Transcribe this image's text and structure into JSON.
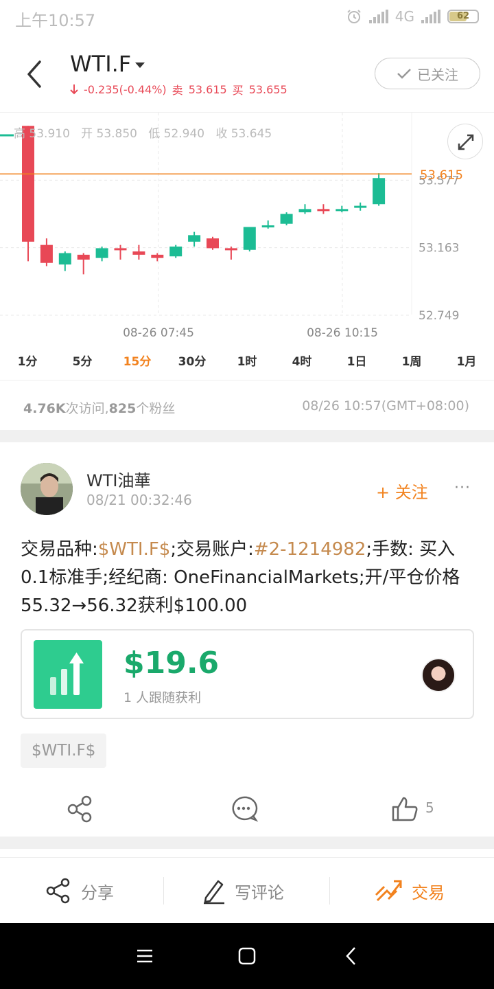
{
  "status_bar": {
    "time": "上午10:57",
    "network": "4G",
    "battery": "62"
  },
  "header": {
    "symbol": "WTI.F",
    "change": "-0.235(-0.44%)",
    "sell_label": "卖",
    "sell_price": "53.615",
    "buy_label": "买",
    "buy_price": "53.655",
    "follow_state": "已关注"
  },
  "chart_data": {
    "type": "candlestick",
    "ohlc_summary": {
      "high": "高 53.910",
      "open": "开 53.850",
      "low": "低 52.940",
      "close": "收 53.645"
    },
    "current_price": 53.615,
    "y_ticks": [
      "53.577",
      "53.163",
      "52.749"
    ],
    "ylim": [
      52.749,
      53.991
    ],
    "x_ticks": [
      "08-26 07:45",
      "08-26 10:15"
    ],
    "candles": [
      {
        "o": 53.91,
        "h": 53.91,
        "l": 53.08,
        "c": 53.2
      },
      {
        "o": 53.18,
        "h": 53.22,
        "l": 53.05,
        "c": 53.07
      },
      {
        "o": 53.06,
        "h": 53.14,
        "l": 53.02,
        "c": 53.13
      },
      {
        "o": 53.12,
        "h": 53.13,
        "l": 53.0,
        "c": 53.09
      },
      {
        "o": 53.1,
        "h": 53.17,
        "l": 53.08,
        "c": 53.16
      },
      {
        "o": 53.16,
        "h": 53.18,
        "l": 53.09,
        "c": 53.15
      },
      {
        "o": 53.14,
        "h": 53.18,
        "l": 53.09,
        "c": 53.12
      },
      {
        "o": 53.12,
        "h": 53.13,
        "l": 53.08,
        "c": 53.1
      },
      {
        "o": 53.11,
        "h": 53.18,
        "l": 53.1,
        "c": 53.17
      },
      {
        "o": 53.2,
        "h": 53.26,
        "l": 53.17,
        "c": 53.24
      },
      {
        "o": 53.22,
        "h": 53.23,
        "l": 53.15,
        "c": 53.16
      },
      {
        "o": 53.16,
        "h": 53.17,
        "l": 53.09,
        "c": 53.15
      },
      {
        "o": 53.15,
        "h": 53.29,
        "l": 53.14,
        "c": 53.29
      },
      {
        "o": 53.29,
        "h": 53.33,
        "l": 53.28,
        "c": 53.3
      },
      {
        "o": 53.31,
        "h": 53.38,
        "l": 53.3,
        "c": 53.37
      },
      {
        "o": 53.38,
        "h": 53.43,
        "l": 53.37,
        "c": 53.4
      },
      {
        "o": 53.4,
        "h": 53.43,
        "l": 53.37,
        "c": 53.39
      },
      {
        "o": 53.39,
        "h": 53.42,
        "l": 53.38,
        "c": 53.4
      },
      {
        "o": 53.41,
        "h": 53.44,
        "l": 53.39,
        "c": 53.42
      },
      {
        "o": 53.43,
        "h": 53.62,
        "l": 53.42,
        "c": 53.59
      }
    ]
  },
  "periods": [
    "1分",
    "5分",
    "15分",
    "30分",
    "1时",
    "4时",
    "1日",
    "1周",
    "1月"
  ],
  "active_period": "15分",
  "stats": {
    "visits": "4.76K",
    "visits_label": "次访问,",
    "fans": "825",
    "fans_label": "个粉丝",
    "timestamp": "08/26 10:57(GMT+08:00)"
  },
  "post": {
    "author": "WTI油華",
    "time": "08/21 00:32:46",
    "follow_label": "+ 关注",
    "more": "···",
    "content": {
      "p1": "交易品种:",
      "symbol": "$WTI.F$",
      "p2": ";交易账户:",
      "account": "#2-1214982",
      "p3": ";手数: 买入 0.1标准手;经纪商: OneFinancialMarkets;开/平仓价格55.32→56.32获利$100.00"
    },
    "profit": "$19.6",
    "profit_sub": "1 人跟随获利",
    "tag": "$WTI.F$",
    "likes": "5"
  },
  "bottom_bar": {
    "share": "分享",
    "comment": "写评论",
    "trade": "交易"
  },
  "colors": {
    "accent": "#f2821e",
    "up": "#1cbc94",
    "down": "#e84856",
    "profit": "#1aa96b"
  }
}
